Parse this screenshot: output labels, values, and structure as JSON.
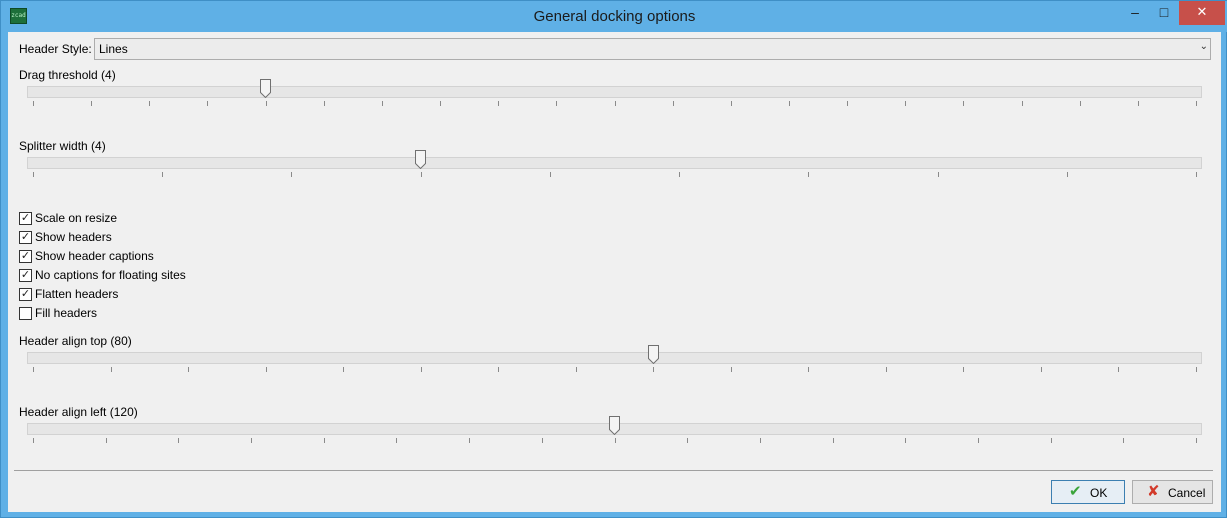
{
  "window": {
    "title": "General docking options",
    "app_icon_text": "zcad",
    "minimize_glyph": "–",
    "maximize_glyph": "□",
    "close_glyph": "✕"
  },
  "header_style": {
    "label": "Header Style:",
    "value": "Lines",
    "arrow": "⌄"
  },
  "sliders": {
    "drag_threshold": {
      "label": "Drag threshold (4)",
      "value": 4,
      "min": 0,
      "max": 20,
      "ticks": 21
    },
    "splitter_width": {
      "label": "Splitter width (4)",
      "value": 4,
      "min": 1,
      "max": 10,
      "ticks": 10
    },
    "header_align_top": {
      "label": "Header align top (80)",
      "value": 80,
      "min": 0,
      "max": 150,
      "ticks": 16
    },
    "header_align_left": {
      "label": "Header align left (120)",
      "value": 120,
      "min": 0,
      "max": 240,
      "ticks": 17
    }
  },
  "checkboxes": [
    {
      "label": "Scale on resize",
      "checked": true
    },
    {
      "label": "Show headers",
      "checked": true
    },
    {
      "label": "Show header captions",
      "checked": true
    },
    {
      "label": "No captions for floating sites",
      "checked": true
    },
    {
      "label": "Flatten headers",
      "checked": true
    },
    {
      "label": "Fill headers",
      "checked": false
    }
  ],
  "buttons": {
    "ok_label": "OK",
    "ok_icon": "✔",
    "cancel_label": "Cancel",
    "cancel_icon": "✘"
  },
  "colors": {
    "title_bar": "#5fb0e6",
    "dialog_bg": "#f0f0f0",
    "close_button": "#c7504a",
    "ok_icon": "#3aa43a",
    "cancel_icon": "#d23a2a"
  }
}
